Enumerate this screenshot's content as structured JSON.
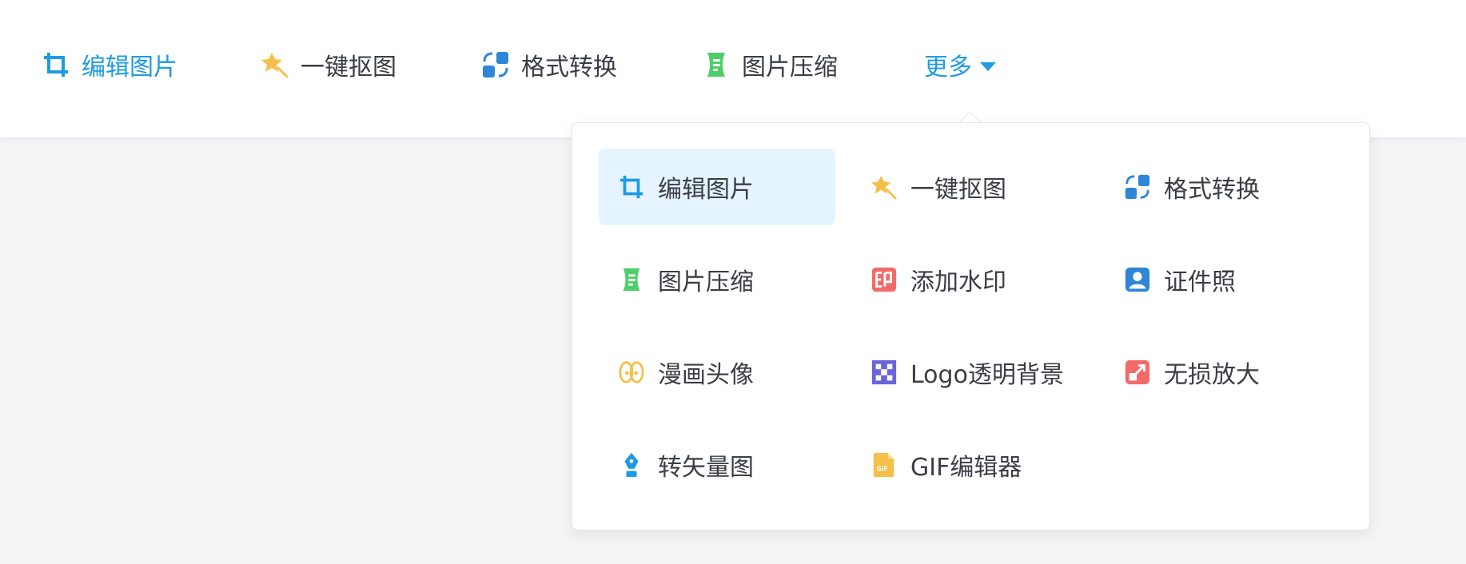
{
  "nav": {
    "items": [
      {
        "label": "编辑图片",
        "icon": "crop-icon",
        "active": true
      },
      {
        "label": "一键抠图",
        "icon": "magic-wand-icon",
        "active": false
      },
      {
        "label": "格式转换",
        "icon": "format-convert-icon",
        "active": false
      },
      {
        "label": "图片压缩",
        "icon": "compress-icon",
        "active": false
      }
    ],
    "more_label": "更多"
  },
  "dropdown": {
    "items": [
      {
        "label": "编辑图片",
        "icon": "crop-icon"
      },
      {
        "label": "一键抠图",
        "icon": "magic-wand-icon"
      },
      {
        "label": "格式转换",
        "icon": "format-convert-icon"
      },
      {
        "label": "图片压缩",
        "icon": "compress-icon"
      },
      {
        "label": "添加水印",
        "icon": "watermark-icon"
      },
      {
        "label": "证件照",
        "icon": "id-photo-icon"
      },
      {
        "label": "漫画头像",
        "icon": "cartoon-avatar-icon"
      },
      {
        "label": "Logo透明背景",
        "icon": "transparent-background-icon"
      },
      {
        "label": "无损放大",
        "icon": "upscale-icon"
      },
      {
        "label": "转矢量图",
        "icon": "vector-pen-icon"
      },
      {
        "label": "GIF编辑器",
        "icon": "gif-file-icon"
      }
    ]
  },
  "colors": {
    "accent": "#1f9be3",
    "text": "#3a3d45",
    "selected_bg": "#e6f4ff",
    "yellow": "#f5c04a",
    "blue": "#2f86d8",
    "green": "#4fcf6b",
    "red": "#f26b6b",
    "purple": "#6b63d9"
  }
}
